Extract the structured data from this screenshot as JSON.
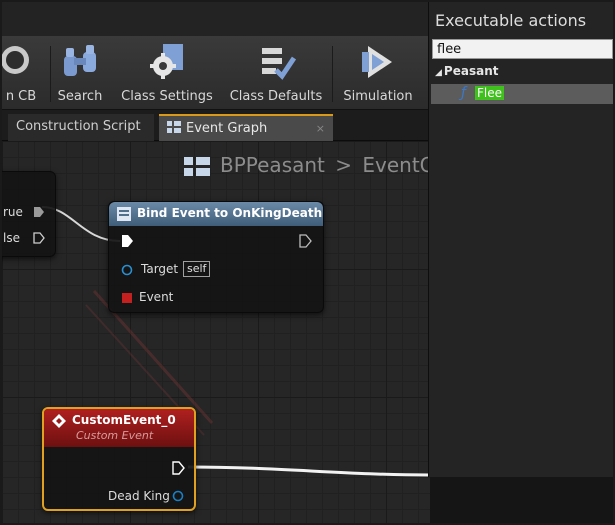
{
  "toolbar": {
    "items": [
      {
        "label": "n CB",
        "icon": "browse-icon"
      },
      {
        "label": "Search",
        "icon": "binoculars-icon"
      },
      {
        "label": "Class Settings",
        "icon": "gear-icon"
      },
      {
        "label": "Class Defaults",
        "icon": "checklist-icon"
      },
      {
        "label": "Simulation",
        "icon": "play-icon"
      }
    ]
  },
  "tabs": {
    "construction": "Construction Script",
    "event_graph": "Event Graph"
  },
  "breadcrumb": {
    "blueprint": "BPPeasant",
    "separator": ">",
    "graph": "EventG"
  },
  "nodes": {
    "branch": {
      "true_label": "rue",
      "false_label": "lse"
    },
    "bind": {
      "title": "Bind Event to OnKingDeath",
      "target_label": "Target",
      "target_value": "self",
      "event_label": "Event"
    },
    "custom": {
      "title": "CustomEvent_0",
      "subtitle": "Custom Event",
      "output_label": "Dead King"
    }
  },
  "actions": {
    "title": "Executable actions",
    "search_value": "flee",
    "category": "Peasant",
    "item": "Flee"
  },
  "colors": {
    "exec_wire": "#ffffff",
    "bind_header": "#4f6f8c",
    "custom_header": "#9a1a1a",
    "selection_outline": "#e0a020",
    "highlight": "#3fc01c",
    "event_pin": "#c42020",
    "delegate_pin": "#1a7fc4"
  }
}
